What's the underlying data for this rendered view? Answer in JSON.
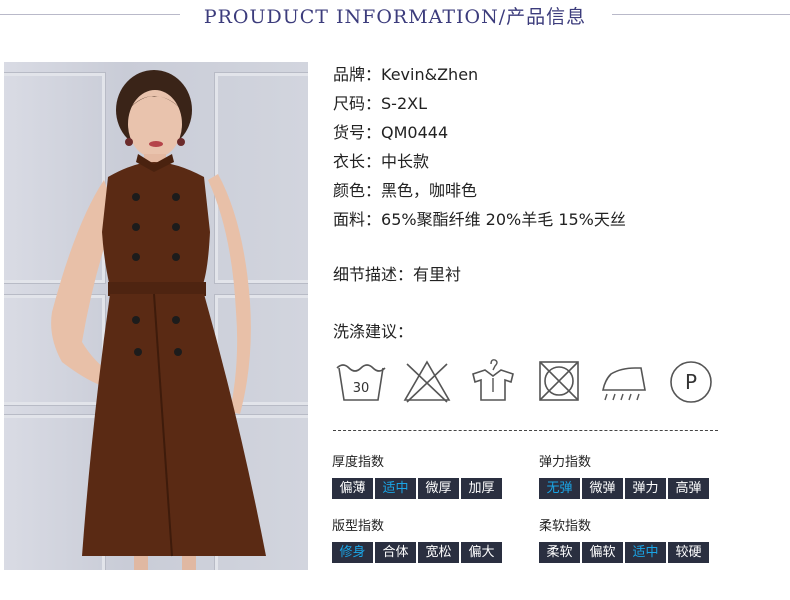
{
  "header": {
    "title": "PROUDUCT INFORMATION/产品信息"
  },
  "specs": [
    {
      "label": "品牌：",
      "value": "Kevin&Zhen"
    },
    {
      "label": "尺码：",
      "value": "S-2XL"
    },
    {
      "label": "货号：",
      "value": "QM0444"
    },
    {
      "label": "衣长：",
      "value": "中长款"
    },
    {
      "label": "颜色：",
      "value": "黑色，咖啡色"
    },
    {
      "label": "面料：",
      "value": "65%聚酯纤维 20%羊毛 15%天丝"
    }
  ],
  "detail": {
    "label": "细节描述：",
    "value": "有里衬"
  },
  "wash": {
    "title": "洗涤建议：",
    "icons": [
      "wash-30-icon",
      "do-not-bleach-icon",
      "hang-dry-icon",
      "do-not-tumble-dry-icon",
      "iron-steam-icon",
      "dry-clean-p-icon"
    ],
    "temp": "30",
    "p_letter": "P"
  },
  "indices": [
    {
      "title": "厚度指数",
      "options": [
        "偏薄",
        "适中",
        "微厚",
        "加厚"
      ],
      "selected": 1
    },
    {
      "title": "弹力指数",
      "options": [
        "无弹",
        "微弹",
        "弹力",
        "高弹"
      ],
      "selected": 0
    },
    {
      "title": "版型指数",
      "options": [
        "修身",
        "合体",
        "宽松",
        "偏大"
      ],
      "selected": 0
    },
    {
      "title": "柔软指数",
      "options": [
        "柔软",
        "偏软",
        "适中",
        "较硬"
      ],
      "selected": 2
    }
  ],
  "colors": {
    "title": "#3c3c7c",
    "option_bg": "#2a2f40",
    "option_selected": "#1aa5e6",
    "dress": "#5a2a14"
  }
}
